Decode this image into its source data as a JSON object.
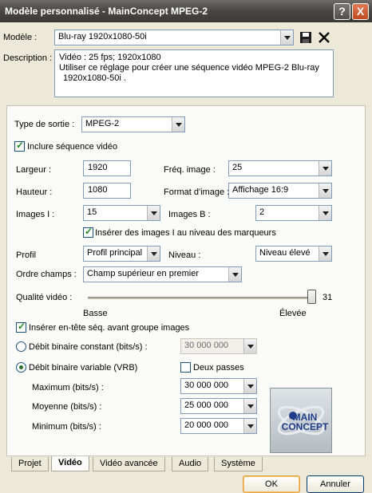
{
  "window": {
    "title": "Modèle personnalisé - MainConcept MPEG-2",
    "help": "?",
    "close": "X"
  },
  "top": {
    "model_label": "Modèle :",
    "model_value": "Blu-ray 1920x1080-50i",
    "desc_label": "Description :",
    "desc_line1": "Vidéo : 25 fps; 1920x1080",
    "desc_line2": "Utiliser ce réglage pour créer une séquence vidéo MPEG-2 Blu-ray",
    "desc_line3": "1920x1080-50i ."
  },
  "video": {
    "output_type_label": "Type de sortie :",
    "output_type_value": "MPEG-2",
    "include_video_label": "Inclure séquence vidéo",
    "width_label": "Largeur :",
    "width_value": "1920",
    "height_label": "Hauteur :",
    "height_value": "1080",
    "frame_rate_label": "Fréq. image :",
    "frame_rate_value": "25",
    "format_label": "Format d'image :",
    "format_value": "Affichage 16:9",
    "i_frames_label": "Images I :",
    "i_frames_value": "15",
    "b_frames_label": "Images B :",
    "b_frames_value": "2",
    "insert_i_label": "Insérer des images I au niveau des marqueurs",
    "profile_label": "Profil",
    "profile_value": "Profil principal",
    "level_label": "Niveau :",
    "level_value": "Niveau élevé",
    "field_order_label": "Ordre champs :",
    "field_order_value": "Champ supérieur en premier",
    "quality_label": "Qualité vidéo :",
    "quality_value": "31",
    "quality_level": 1.0,
    "low_label": "Basse",
    "high_label": "Élevée",
    "insert_header_label": "Insérer en-tête séq. avant groupe images",
    "cbr_label": "Débit binaire constant (bits/s) :",
    "cbr_value": "30 000 000",
    "vbr_label": "Débit binaire variable (VRB)",
    "two_pass_label": "Deux passes",
    "max_label": "Maximum (bits/s) :",
    "max_value": "30 000 000",
    "avg_label": "Moyenne (bits/s) :",
    "avg_value": "25 000 000",
    "min_label": "Minimum (bits/s) :",
    "min_value": "20 000 000",
    "logo_text": "MAIN CONCEPT"
  },
  "tabs": [
    "Projet",
    "Vidéo",
    "Vidéo avancée",
    "Audio",
    "Système"
  ],
  "buttons": {
    "ok": "OK",
    "cancel": "Annuler"
  }
}
